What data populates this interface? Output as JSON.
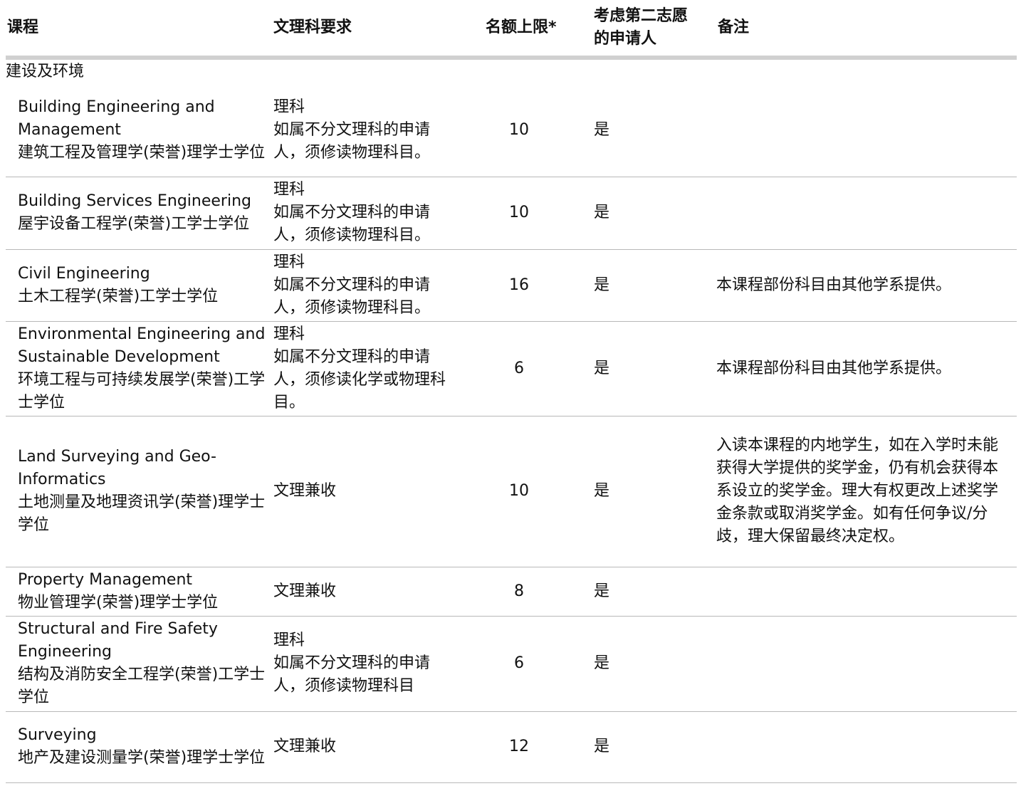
{
  "headers": {
    "course": "课程",
    "requirement": "文理科要求",
    "quota": "名额上限*",
    "second_choice_line1": "考虑第二志愿",
    "second_choice_line2": "的申请人",
    "remarks": "备注"
  },
  "group": {
    "name": "建设及环境"
  },
  "rows": [
    {
      "name_en": "Building Engineering and Management",
      "name_zh": "建筑工程及管理学(荣誉)理学士学位",
      "requirement_line1": "理科",
      "requirement_line2": "如属不分文理科的申请人，须修读物理科目。",
      "quota": "10",
      "second_choice": "是",
      "remark": ""
    },
    {
      "name_en": "Building Services Engineering",
      "name_zh": "屋宇设备工程学(荣誉)工学士学位",
      "requirement_line1": "理科",
      "requirement_line2": "如属不分文理科的申请人，须修读物理科目。",
      "quota": "10",
      "second_choice": "是",
      "remark": ""
    },
    {
      "name_en": "Civil Engineering",
      "name_zh": "土木工程学(荣誉)工学士学位",
      "requirement_line1": "理科",
      "requirement_line2": "如属不分文理科的申请人，须修读物理科目。",
      "quota": "16",
      "second_choice": "是",
      "remark": "本课程部份科目由其他学系提供。"
    },
    {
      "name_en": "Environmental Engineering and Sustainable Development",
      "name_zh": "环境工程与可持续发展学(荣誉)工学士学位",
      "requirement_line1": "理科",
      "requirement_line2": "如属不分文理科的申请人，须修读化学或物理科目。",
      "quota": "6",
      "second_choice": "是",
      "remark": "本课程部份科目由其他学系提供。"
    },
    {
      "name_en": "Land Surveying and Geo-Informatics",
      "name_zh": "土地测量及地理资讯学(荣誉)理学士学位",
      "requirement_line1": "文理兼收",
      "requirement_line2": "",
      "quota": "10",
      "second_choice": "是",
      "remark": "入读本课程的内地学生，如在入学时未能获得大学提供的奖学金，仍有机会获得本系设立的奖学金。理大有权更改上述奖学金条款或取消奖学金。如有任何争议/分歧，理大保留最终决定权。"
    },
    {
      "name_en": "Property Management",
      "name_zh": "物业管理学(荣誉)理学士学位",
      "requirement_line1": "文理兼收",
      "requirement_line2": "",
      "quota": "8",
      "second_choice": "是",
      "remark": ""
    },
    {
      "name_en": "Structural and Fire Safety Engineering",
      "name_zh": "结构及消防安全工程学(荣誉)工学士学位",
      "requirement_line1": "理科",
      "requirement_line2": "如属不分文理科的申请人，须修读物理科目",
      "quota": "6",
      "second_choice": "是",
      "remark": ""
    },
    {
      "name_en": "Surveying",
      "name_zh": "地产及建设测量学(荣誉)理学士学位",
      "requirement_line1": "文理兼收",
      "requirement_line2": "",
      "quota": "12",
      "second_choice": "是",
      "remark": ""
    }
  ]
}
